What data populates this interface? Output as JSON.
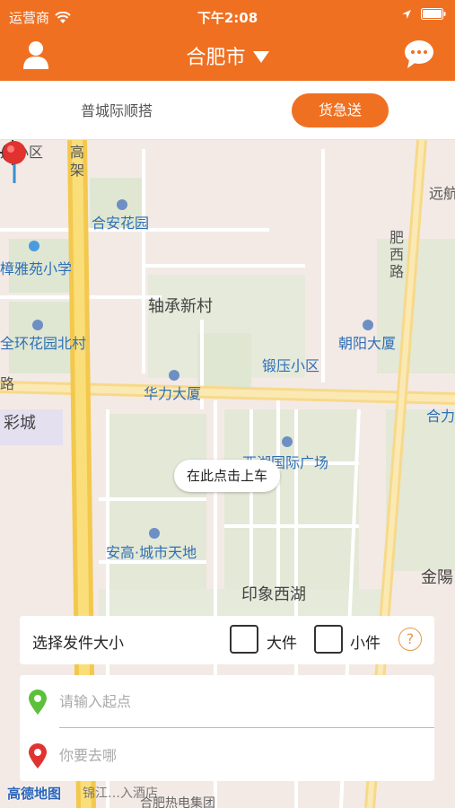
{
  "status_bar": {
    "carrier": "运营商",
    "time": "下午2:08"
  },
  "nav": {
    "city": "合肥市"
  },
  "tabs": {
    "left": "普城际顺搭",
    "right": "货急送"
  },
  "map": {
    "callout": "在此点击上车",
    "labels": {
      "l1": "高",
      "l2": "架",
      "l3": "合安花园",
      "l4": "樟雅苑小学",
      "l5": "轴承新村",
      "l6": "朝阳大厦",
      "l7": "全环花园北村",
      "l8": "锻压小区",
      "l9": "华力大厦",
      "l10": "彩城",
      "l11": "西湖国际广场",
      "l12": "安高·城市天地",
      "l13": "印象西湖",
      "l14": "金陽",
      "l15": "合力",
      "l16": "远航",
      "l17": "肥",
      "l18": "西",
      "l19": "路",
      "l20": "路",
      "l21": "儿小区",
      "l22": "合肥热电集团",
      "l23": "锦江…入酒店"
    },
    "logo": "高德地图"
  },
  "size_panel": {
    "title": "选择发件大小",
    "large": "大件",
    "small": "小件",
    "help": "?"
  },
  "address": {
    "start_placeholder": "请输入起点",
    "dest_placeholder": "你要去哪"
  },
  "colors": {
    "accent": "#f07021",
    "start_icon": "#5cc03a",
    "dest_icon": "#e0322f"
  }
}
